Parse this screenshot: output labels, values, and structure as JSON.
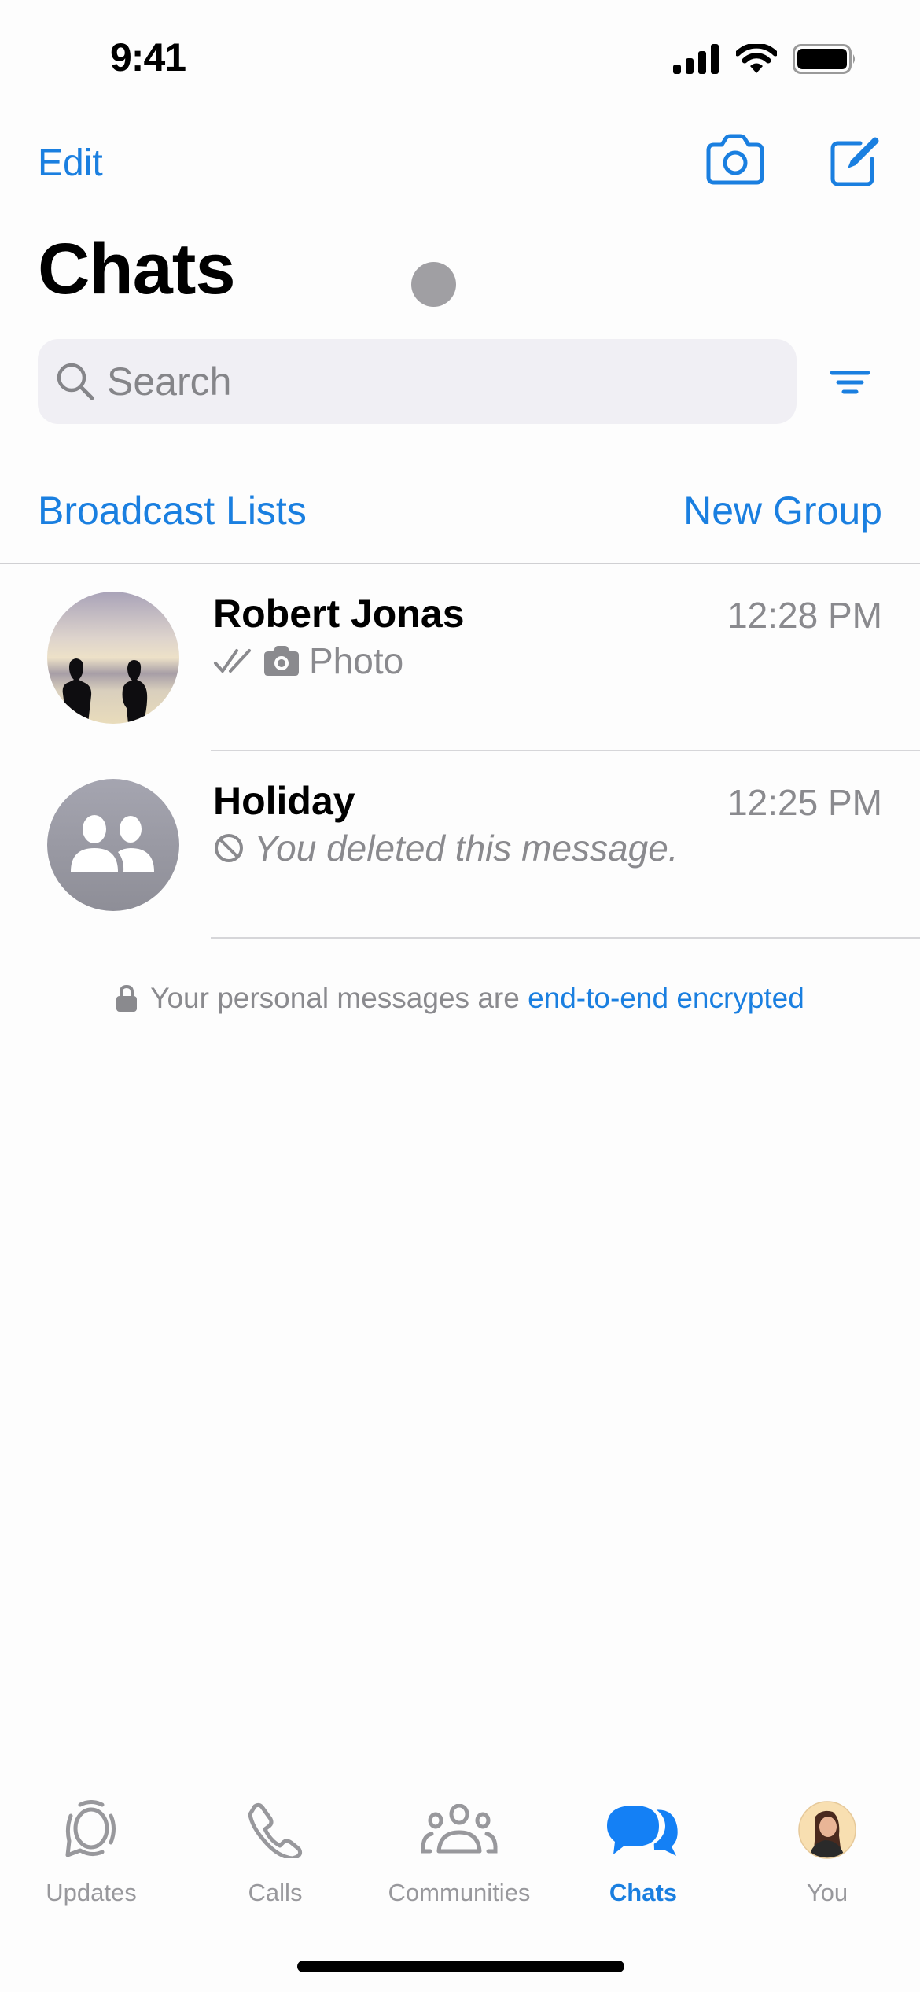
{
  "status_bar": {
    "time": "9:41",
    "icons": [
      "cellular-signal-icon",
      "wifi-icon",
      "battery-icon"
    ]
  },
  "nav": {
    "edit_label": "Edit",
    "camera_icon": "camera-icon",
    "compose_icon": "compose-icon"
  },
  "page_title": "Chats",
  "search": {
    "placeholder": "Search",
    "value": "",
    "icon": "search-icon",
    "filter_icon": "filter-icon"
  },
  "links": {
    "broadcast": "Broadcast Lists",
    "new_group": "New Group"
  },
  "chats": [
    {
      "name": "Robert Jonas",
      "time": "12:28 PM",
      "status_icon": "double-check-icon",
      "media_icon": "camera-icon",
      "preview": "Photo",
      "avatar": "photo-two-silhouettes-sunset"
    },
    {
      "name": "Holiday",
      "time": "12:25 PM",
      "status_icon": "deleted-icon",
      "preview": "You deleted this message.",
      "avatar": "group-placeholder-icon"
    }
  ],
  "e2e_notice": {
    "text": "Your personal messages are",
    "link": "end-to-end encrypted",
    "icon": "lock-icon"
  },
  "tabs": [
    {
      "label": "Updates",
      "icon": "updates-icon",
      "active": false
    },
    {
      "label": "Calls",
      "icon": "phone-icon",
      "active": false
    },
    {
      "label": "Communities",
      "icon": "communities-icon",
      "active": false
    },
    {
      "label": "Chats",
      "icon": "chats-icon",
      "active": true
    },
    {
      "label": "You",
      "icon": "profile-avatar",
      "active": false
    }
  ],
  "colors": {
    "accent": "#1a7fe0",
    "secondary_text": "#8a8a8e",
    "search_bg": "#f0eff4",
    "tab_inactive": "#98989c",
    "active_tab_icon": "#1480f5"
  }
}
